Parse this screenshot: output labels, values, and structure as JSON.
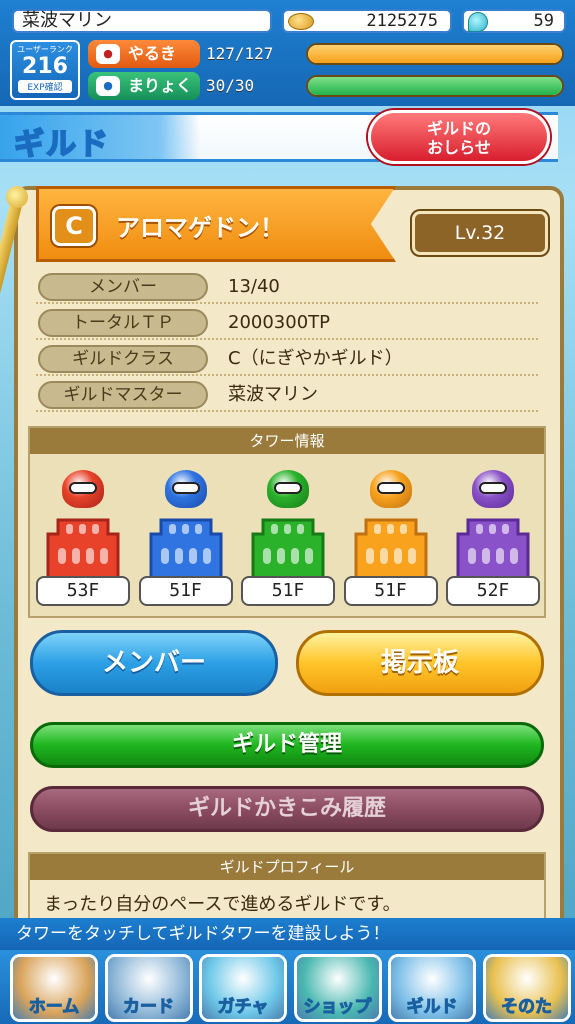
{
  "status": {
    "player_name": "菜波マリン",
    "coins": "2125275",
    "gems": "59",
    "rank_label": "ユーザーランク",
    "rank_value": "216",
    "exp_label": "EXP確認",
    "stamina": {
      "label": "やるき",
      "value": "127/127",
      "fill": 1.0,
      "color": "#f6a21a"
    },
    "mana": {
      "label": "まりょく",
      "value": "30/30",
      "fill": 1.0,
      "color": "#22b24a"
    }
  },
  "header": {
    "title": "ギルド",
    "news_button": "ギルドの\nおしらせ"
  },
  "guild": {
    "class_letter": "C",
    "name": "アロマゲドン！",
    "level": "Lv.32",
    "info": [
      {
        "label": "メンバー",
        "value": "13/40"
      },
      {
        "label": "トータルＴＰ",
        "value": "2000300TP"
      },
      {
        "label": "ギルドクラス",
        "value": "C（にぎやかギルド）"
      },
      {
        "label": "ギルドマスター",
        "value": "菜波マリン"
      }
    ]
  },
  "towers": {
    "header": "タワー情報",
    "items": [
      {
        "floor": "53F",
        "color": "#e8432a",
        "dark": "#a8241a",
        "name": "red"
      },
      {
        "floor": "51F",
        "color": "#2f74e0",
        "dark": "#1a4aa8",
        "name": "blue"
      },
      {
        "floor": "51F",
        "color": "#2bb22b",
        "dark": "#167a16",
        "name": "green"
      },
      {
        "floor": "51F",
        "color": "#f8a21e",
        "dark": "#c07010",
        "name": "yellow"
      },
      {
        "floor": "52F",
        "color": "#8a52c8",
        "dark": "#5a2a98",
        "name": "purple"
      }
    ]
  },
  "buttons": {
    "member": "メンバー",
    "board": "掲示板",
    "manage": "ギルド管理",
    "history": "ギルドかきこみ履歴"
  },
  "profile": {
    "header": "ギルドプロフィール",
    "text": "まったり自分のペースで進めるギルドです。"
  },
  "tip": "タワーをタッチしてギルドタワーを建設しよう！",
  "nav": [
    {
      "label": "ホーム",
      "name": "home",
      "bg": "#d9a35a"
    },
    {
      "label": "カード",
      "name": "card",
      "bg": "#8fb8d8"
    },
    {
      "label": "ガチャ",
      "name": "gacha",
      "bg": "#6ec8e8"
    },
    {
      "label": "ショップ",
      "name": "shop",
      "bg": "#4ab8b0"
    },
    {
      "label": "ギルド",
      "name": "guild",
      "bg": "#7ec0e8"
    },
    {
      "label": "そのた",
      "name": "other",
      "bg": "#e8c050"
    }
  ]
}
